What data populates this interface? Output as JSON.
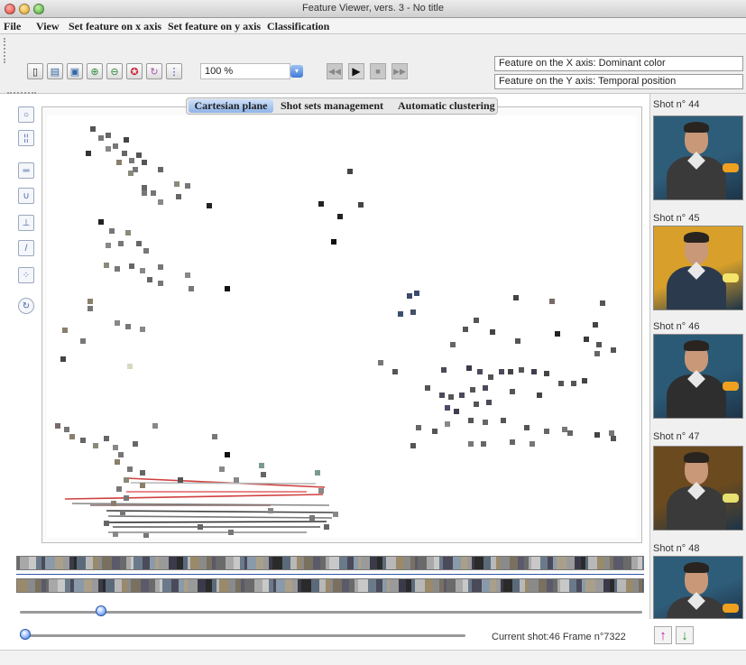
{
  "window": {
    "title": "Feature Viewer, vers. 3 - No title"
  },
  "menu": [
    "File",
    "View",
    "Set feature on x axis",
    "Set feature on y axis",
    "Classification"
  ],
  "toolbar": {
    "zoom": "100 %"
  },
  "axis_info": {
    "x": "Feature on the X axis: Dominant color",
    "y": "Feature on the Y axis: Temporal position"
  },
  "tabs": [
    "Cartesian plane",
    "Shot sets management",
    "Automatic clustering"
  ],
  "shots": [
    {
      "label": "Shot n° 44",
      "bg": "#2e5d7a",
      "fg": "#3a3a3a",
      "accent": "#f0a020"
    },
    {
      "label": "Shot n° 45",
      "bg": "#d8a02a",
      "fg": "#2c3a4e",
      "accent": "#f4e46a"
    },
    {
      "label": "Shot n° 46",
      "bg": "#2b5a76",
      "fg": "#2e2e2e",
      "accent": "#f0a020"
    },
    {
      "label": "Shot n° 47",
      "bg": "#6a4a1e",
      "fg": "#3a3a3a",
      "accent": "#e6e070"
    },
    {
      "label": "Shot n° 48",
      "bg": "#2e5d7a",
      "fg": "#3a3a3a",
      "accent": "#f0a020"
    }
  ],
  "status": {
    "text": "Current shot:46 Frame n°7322"
  },
  "sliders": {
    "upper_value": 0.13,
    "lower_value": 0.0
  },
  "chart_data": {
    "type": "scatter",
    "points": [
      [
        103,
        143,
        "#555"
      ],
      [
        112,
        153,
        "#777"
      ],
      [
        120,
        150,
        "#666"
      ],
      [
        128,
        162,
        "#777"
      ],
      [
        138,
        170,
        "#666"
      ],
      [
        146,
        178,
        "#777"
      ],
      [
        154,
        172,
        "#555"
      ],
      [
        140,
        155,
        "#444"
      ],
      [
        98,
        170,
        "#333"
      ],
      [
        120,
        165,
        "#888"
      ],
      [
        132,
        180,
        "#8a7f6a"
      ],
      [
        150,
        188,
        "#777"
      ],
      [
        145,
        192,
        "#8a8a7a"
      ],
      [
        160,
        180,
        "#555"
      ],
      [
        178,
        188,
        "#666"
      ],
      [
        160,
        208,
        "#666"
      ],
      [
        170,
        214,
        "#777"
      ],
      [
        196,
        204,
        "#8a8a7a"
      ],
      [
        208,
        206,
        "#777"
      ],
      [
        198,
        218,
        "#666"
      ],
      [
        178,
        224,
        "#888"
      ],
      [
        160,
        214,
        "#777"
      ],
      [
        232,
        228,
        "#222"
      ],
      [
        112,
        246,
        "#222"
      ],
      [
        124,
        256,
        "#777"
      ],
      [
        142,
        258,
        "#8a8a7a"
      ],
      [
        134,
        270,
        "#777"
      ],
      [
        120,
        272,
        "#888"
      ],
      [
        154,
        270,
        "#666"
      ],
      [
        162,
        278,
        "#777"
      ],
      [
        118,
        294,
        "#8a8a7a"
      ],
      [
        130,
        298,
        "#777"
      ],
      [
        146,
        295,
        "#666"
      ],
      [
        158,
        300,
        "#888"
      ],
      [
        178,
        296,
        "#777"
      ],
      [
        178,
        314,
        "#777"
      ],
      [
        166,
        310,
        "#666"
      ],
      [
        208,
        305,
        "#888"
      ],
      [
        212,
        320,
        "#777"
      ],
      [
        252,
        320,
        "#111"
      ],
      [
        100,
        334,
        "#8a7f6a"
      ],
      [
        100,
        342,
        "#777"
      ],
      [
        130,
        358,
        "#888"
      ],
      [
        142,
        362,
        "#777"
      ],
      [
        72,
        366,
        "#8a7f6a"
      ],
      [
        92,
        378,
        "#777"
      ],
      [
        158,
        365,
        "#888"
      ],
      [
        70,
        398,
        "#444"
      ],
      [
        144,
        406,
        "#d8d8c0"
      ],
      [
        356,
        226,
        "#222"
      ],
      [
        377,
        240,
        "#222"
      ],
      [
        388,
        190,
        "#444"
      ],
      [
        400,
        227,
        "#444"
      ],
      [
        370,
        268,
        "#111"
      ],
      [
        454,
        328,
        "#3c4a6a"
      ],
      [
        462,
        325,
        "#3c4a70"
      ],
      [
        444,
        348,
        "#3a5070"
      ],
      [
        458,
        346,
        "#445066"
      ],
      [
        572,
        330,
        "#444"
      ],
      [
        612,
        334,
        "#7a6a6a"
      ],
      [
        668,
        336,
        "#555"
      ],
      [
        528,
        355,
        "#555"
      ],
      [
        516,
        365,
        "#555"
      ],
      [
        502,
        382,
        "#666"
      ],
      [
        546,
        368,
        "#444"
      ],
      [
        574,
        378,
        "#555"
      ],
      [
        618,
        370,
        "#222"
      ],
      [
        650,
        376,
        "#3a3a3a"
      ],
      [
        664,
        382,
        "#555"
      ],
      [
        660,
        360,
        "#444"
      ],
      [
        680,
        388,
        "#555"
      ],
      [
        662,
        392,
        "#666"
      ],
      [
        422,
        402,
        "#777"
      ],
      [
        438,
        412,
        "#555"
      ],
      [
        492,
        410,
        "#4a4a5a"
      ],
      [
        520,
        408,
        "#3a3a4a"
      ],
      [
        532,
        412,
        "#4a4a5a"
      ],
      [
        544,
        418,
        "#555"
      ],
      [
        556,
        412,
        "#4a4a5a"
      ],
      [
        566,
        412,
        "#444"
      ],
      [
        578,
        410,
        "#555"
      ],
      [
        592,
        412,
        "#3e3e4e"
      ],
      [
        606,
        414,
        "#444"
      ],
      [
        622,
        425,
        "#555"
      ],
      [
        636,
        425,
        "#555"
      ],
      [
        648,
        422,
        "#444"
      ],
      [
        474,
        430,
        "#555"
      ],
      [
        490,
        438,
        "#4a4a5a"
      ],
      [
        500,
        440,
        "#555"
      ],
      [
        512,
        438,
        "#4a4a5a"
      ],
      [
        524,
        432,
        "#555"
      ],
      [
        538,
        430,
        "#4a4a5a"
      ],
      [
        496,
        452,
        "#4a4a6a"
      ],
      [
        506,
        456,
        "#3e3e4e"
      ],
      [
        528,
        448,
        "#555"
      ],
      [
        542,
        446,
        "#4a4a5a"
      ],
      [
        568,
        434,
        "#555"
      ],
      [
        598,
        438,
        "#444"
      ],
      [
        464,
        474,
        "#666"
      ],
      [
        482,
        478,
        "#555"
      ],
      [
        496,
        470,
        "#888"
      ],
      [
        522,
        466,
        "#555"
      ],
      [
        538,
        468,
        "#666"
      ],
      [
        558,
        466,
        "#555"
      ],
      [
        584,
        474,
        "#555"
      ],
      [
        606,
        478,
        "#666"
      ],
      [
        626,
        476,
        "#777"
      ],
      [
        662,
        482,
        "#444"
      ],
      [
        680,
        486,
        "#555"
      ],
      [
        458,
        494,
        "#555"
      ],
      [
        522,
        492,
        "#777"
      ],
      [
        536,
        492,
        "#666"
      ],
      [
        568,
        490,
        "#666"
      ],
      [
        590,
        492,
        "#777"
      ],
      [
        632,
        480,
        "#666"
      ],
      [
        678,
        480,
        "#777"
      ],
      [
        64,
        472,
        "#7a6a6a"
      ],
      [
        74,
        476,
        "#777"
      ],
      [
        80,
        484,
        "#8a7f6a"
      ],
      [
        92,
        488,
        "#666"
      ],
      [
        106,
        494,
        "#8a8a7a"
      ],
      [
        118,
        486,
        "#666"
      ],
      [
        128,
        496,
        "#888"
      ],
      [
        134,
        504,
        "#777"
      ],
      [
        150,
        492,
        "#666"
      ],
      [
        172,
        472,
        "#888"
      ],
      [
        238,
        484,
        "#777"
      ],
      [
        130,
        512,
        "#8a7f6a"
      ],
      [
        144,
        520,
        "#777"
      ],
      [
        158,
        524,
        "#666"
      ],
      [
        140,
        532,
        "#8a8a7a"
      ],
      [
        132,
        542,
        "#777"
      ],
      [
        158,
        538,
        "#8a7f6a"
      ],
      [
        200,
        532,
        "#555"
      ],
      [
        252,
        504,
        "#111"
      ],
      [
        262,
        532,
        "#888"
      ],
      [
        290,
        516,
        "#7a9a90"
      ],
      [
        292,
        526,
        "#666"
      ],
      [
        246,
        520,
        "#888"
      ],
      [
        140,
        552,
        "#777"
      ],
      [
        126,
        558,
        "#8a7f6a"
      ],
      [
        136,
        568,
        "#777"
      ],
      [
        118,
        580,
        "#666"
      ],
      [
        128,
        592,
        "#888"
      ],
      [
        162,
        594,
        "#777"
      ],
      [
        222,
        584,
        "#666"
      ],
      [
        256,
        590,
        "#777"
      ],
      [
        300,
        566,
        "#888"
      ],
      [
        346,
        574,
        "#777"
      ],
      [
        352,
        524,
        "#7a9a90"
      ],
      [
        356,
        544,
        "#888"
      ],
      [
        362,
        584,
        "#666"
      ],
      [
        372,
        570,
        "#888"
      ]
    ],
    "lines": [
      [
        140,
        530,
        360,
        540,
        "#d04040"
      ],
      [
        145,
        535,
        350,
        536,
        "#b8b8b8"
      ],
      [
        72,
        553,
        358,
        548,
        "#d04040"
      ],
      [
        80,
        558,
        365,
        560,
        "#888"
      ],
      [
        118,
        566,
        370,
        568,
        "#444"
      ],
      [
        120,
        572,
        368,
        574,
        "#777"
      ],
      [
        118,
        579,
        362,
        578,
        "#333"
      ],
      [
        125,
        584,
        355,
        584,
        "#555"
      ],
      [
        120,
        590,
        340,
        590,
        "#888"
      ],
      [
        100,
        560,
        300,
        560,
        "#8a6a6a"
      ],
      [
        140,
        545,
        340,
        545,
        "#e06060"
      ]
    ]
  }
}
